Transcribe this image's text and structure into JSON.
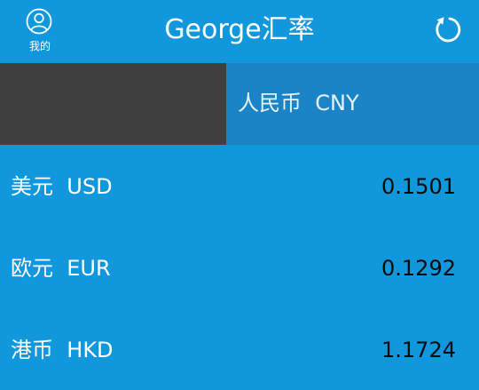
{
  "header": {
    "profile_label": "我的",
    "title": "George汇率",
    "profile_icon": "user-icon",
    "refresh_icon": "refresh-icon"
  },
  "base": {
    "amount_value": "",
    "currency_name": "人民币",
    "currency_code": "CNY"
  },
  "rates": [
    {
      "name": "美元",
      "code": "USD",
      "value": "0.1501"
    },
    {
      "name": "欧元",
      "code": "EUR",
      "value": "0.1292"
    },
    {
      "name": "港币",
      "code": "HKD",
      "value": "1.1724"
    }
  ],
  "colors": {
    "primary": "#1197dc",
    "input_bg": "#404040",
    "base_currency_bg": "#1b84c6",
    "rate_text": "#0a0a0a"
  }
}
